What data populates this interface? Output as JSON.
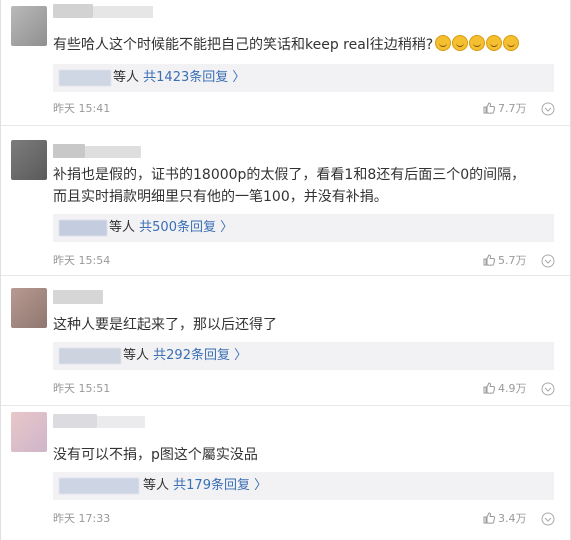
{
  "comments": [
    {
      "text_lines": [
        "有些哈人这个时候能不能把自己的笑话和keep real往边稍稍?"
      ],
      "emoji_icon": "laughing-tears-emoji",
      "emoji_count": 5,
      "reply_suffix": "等人",
      "reply_link": "共1423条回复 〉",
      "time": "昨天 15:41",
      "likes": "7.7万"
    },
    {
      "text_lines": [
        "补捐也是假的，证书的18000p的太假了，看看1和8还有后面三个0的间隔，",
        "而且实时捐款明细里只有他的一笔100，并没有补捐。"
      ],
      "reply_suffix": "等人",
      "reply_link": "共500条回复 〉",
      "time": "昨天 15:54",
      "likes": "5.7万"
    },
    {
      "text_lines": [
        "这种人要是红起来了，那以后还得了"
      ],
      "reply_suffix": "等人",
      "reply_link": "共292条回复 〉",
      "time": "昨天 15:51",
      "likes": "4.9万"
    },
    {
      "text_lines": [
        "没有可以不捐，p图这个屬实没品"
      ],
      "reply_suffix": "等人",
      "reply_link": "共179条回复 〉",
      "time": "昨天 17:33",
      "likes": "3.4万"
    }
  ],
  "icons": {
    "like": "thumbs-up-icon",
    "more": "chevron-down-circle-icon"
  },
  "colors": {
    "link": "#3a6fb4",
    "meta": "#999999",
    "reply_bg": "#f2f2f5"
  }
}
